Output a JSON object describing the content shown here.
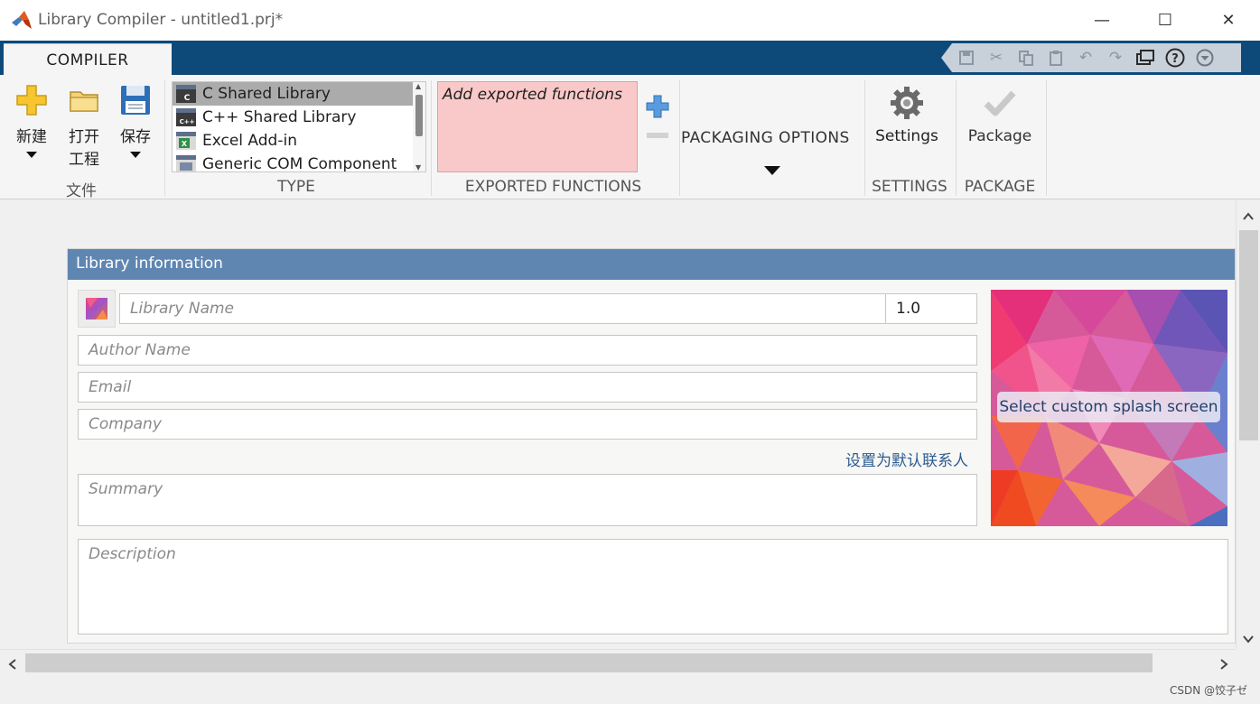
{
  "window": {
    "title": "Library Compiler - untitled1.prj*",
    "controls": {
      "minimize": "—",
      "maximize": "☐",
      "close": "✕"
    }
  },
  "ribbon": {
    "tab": "COMPILER",
    "file_group": {
      "label": "文件",
      "new_label": "新建",
      "open_label_line1": "打开",
      "open_label_line2": "工程",
      "save_label": "保存"
    },
    "type_group": {
      "label": "TYPE",
      "items": [
        "C Shared Library",
        "C++ Shared Library",
        "Excel Add-in",
        "Generic COM Component"
      ],
      "selected": "C Shared Library"
    },
    "exported_group": {
      "label": "EXPORTED FUNCTIONS",
      "placeholder": "Add exported functions"
    },
    "packaging_options": {
      "label": "PACKAGING OPTIONS"
    },
    "settings_group": {
      "label": "SETTINGS",
      "button_label": "Settings"
    },
    "package_group": {
      "label": "PACKAGE",
      "button_label": "Package"
    }
  },
  "library_info": {
    "header": "Library information",
    "library_name_placeholder": "Library Name",
    "version": "1.0",
    "author_placeholder": "Author Name",
    "email_placeholder": "Email",
    "company_placeholder": "Company",
    "set_default_contact": "设置为默认联系人",
    "summary_placeholder": "Summary",
    "description_placeholder": "Description",
    "splash_button": "Select custom splash screen"
  },
  "footer": {
    "watermark": "CSDN @饺子ゼ"
  },
  "colors": {
    "title_bar": "#ffffff",
    "strip": "#0d4a7a",
    "panel_header": "#5f86b1",
    "exported_bg": "#f9c8c8",
    "link": "#2d5c8e"
  }
}
